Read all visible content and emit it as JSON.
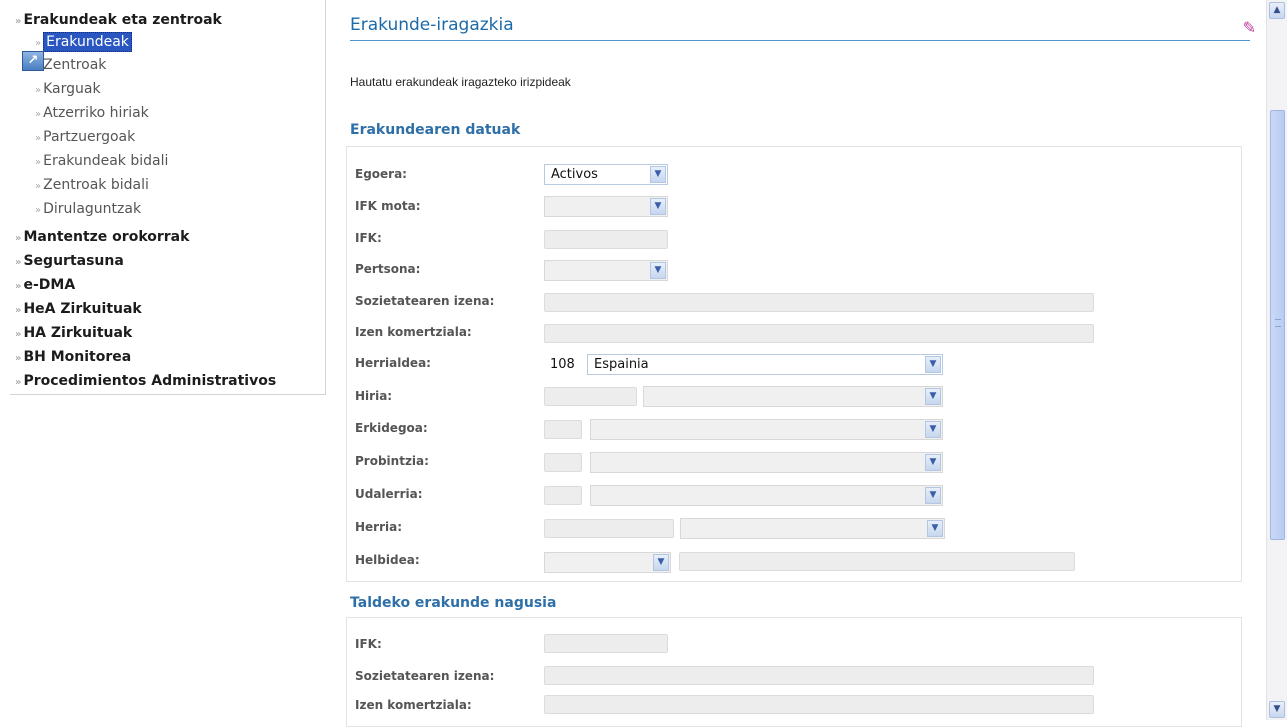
{
  "sidebar": {
    "items": [
      {
        "label": "Erakundeak eta zentroak",
        "level": "top"
      },
      {
        "label": "Erakundeak",
        "level": "sub",
        "selected": true
      },
      {
        "label": "Zentroak",
        "level": "sub"
      },
      {
        "label": "Karguak",
        "level": "sub"
      },
      {
        "label": "Atzerriko hiriak",
        "level": "sub"
      },
      {
        "label": "Partzuergoak",
        "level": "sub"
      },
      {
        "label": "Erakundeak bidali",
        "level": "sub"
      },
      {
        "label": "Zentroak bidali",
        "level": "sub"
      },
      {
        "label": "Dirulaguntzak",
        "level": "sub"
      },
      {
        "label": "Mantentze orokorrak",
        "level": "top"
      },
      {
        "label": "Segurtasuna",
        "level": "top"
      },
      {
        "label": "e-DMA",
        "level": "top"
      },
      {
        "label": "HeA Zirkuituak",
        "level": "top"
      },
      {
        "label": "HA Zirkuituak",
        "level": "top"
      },
      {
        "label": "BH Monitorea",
        "level": "top"
      },
      {
        "label": "Procedimientos Administrativos",
        "level": "top"
      }
    ],
    "chevron": "»"
  },
  "main": {
    "title": "Erakunde-iragazkia",
    "intro": "Hautatu erakundeak iragazteko irizpideak",
    "section1": {
      "title": "Erakundearen datuak",
      "fields": {
        "egoera": {
          "label": "Egoera:",
          "value": "Activos"
        },
        "ifk_mota": {
          "label": "IFK mota:"
        },
        "ifk": {
          "label": "IFK:"
        },
        "pertsona": {
          "label": "Pertsona:"
        },
        "sozietatea": {
          "label": "Sozietatearen izena:"
        },
        "izen_komertziala": {
          "label": "Izen komertziala:"
        },
        "herrialdea": {
          "label": "Herrialdea:",
          "code": "108",
          "value": "Espainia"
        },
        "hiria": {
          "label": "Hiria:"
        },
        "erkidegoa": {
          "label": "Erkidegoa:"
        },
        "probintzia": {
          "label": "Probintzia:"
        },
        "udalerria": {
          "label": "Udalerria:"
        },
        "herria": {
          "label": "Herria:"
        },
        "helbidea": {
          "label": "Helbidea:"
        }
      }
    },
    "section2": {
      "title": "Taldeko erakunde nagusia",
      "fields": {
        "ifk": {
          "label": "IFK:"
        },
        "sozietatea": {
          "label": "Sozietatearen izena:"
        },
        "izen_komertziala": {
          "label": "Izen komertziala:"
        }
      }
    }
  },
  "icons": {
    "eraser": "eraser-icon",
    "dropdown": "chevron-down-icon"
  },
  "colors": {
    "accent": "#1c6aa8",
    "selection": "#2a56c2"
  }
}
